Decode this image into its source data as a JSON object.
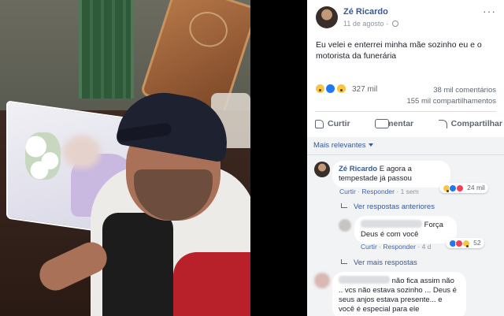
{
  "post": {
    "author": "Zé Ricardo",
    "date": "11 de agosto",
    "date_sep": "·",
    "text": "Eu velei e enterrei minha mãe sozinho eu e o motorista da funerária",
    "reactions": {
      "count": "327 mil",
      "icons": [
        "sad-icon",
        "like-icon",
        "wow-icon"
      ]
    },
    "comments_count": "38 mil comentários",
    "shares_count": "155 mil compartilhamentos",
    "actions": {
      "like": "Curtir",
      "comment": "Comentar",
      "share": "Compartilhar"
    },
    "more": "···"
  },
  "comments": {
    "filter_label": "Mais relevantes",
    "items": [
      {
        "author": "Zé Ricardo",
        "text": "E agora a tempestade já passou",
        "like": "Curtir",
        "reply": "Responder",
        "sep": "·",
        "time": "1 sem",
        "reactions": "24 mil"
      }
    ],
    "previous_replies": "Ver respostas anteriores",
    "reply": {
      "text": "Força Deus é com você",
      "like": "Curtir",
      "reply": "Responder",
      "sep": "·",
      "time": "4 d",
      "reactions": "52"
    },
    "more_replies": "Ver mais respostas",
    "third": {
      "text": "não fica assim não .. vcs não estava sozinho ... Deus é seus anjos estava presente... e você é especial para ele"
    }
  },
  "colors": {
    "link": "#385898",
    "text": "#1d2129",
    "muted": "#606770",
    "panel_bg": "#ffffff",
    "comments_bg": "#f2f3f5"
  }
}
